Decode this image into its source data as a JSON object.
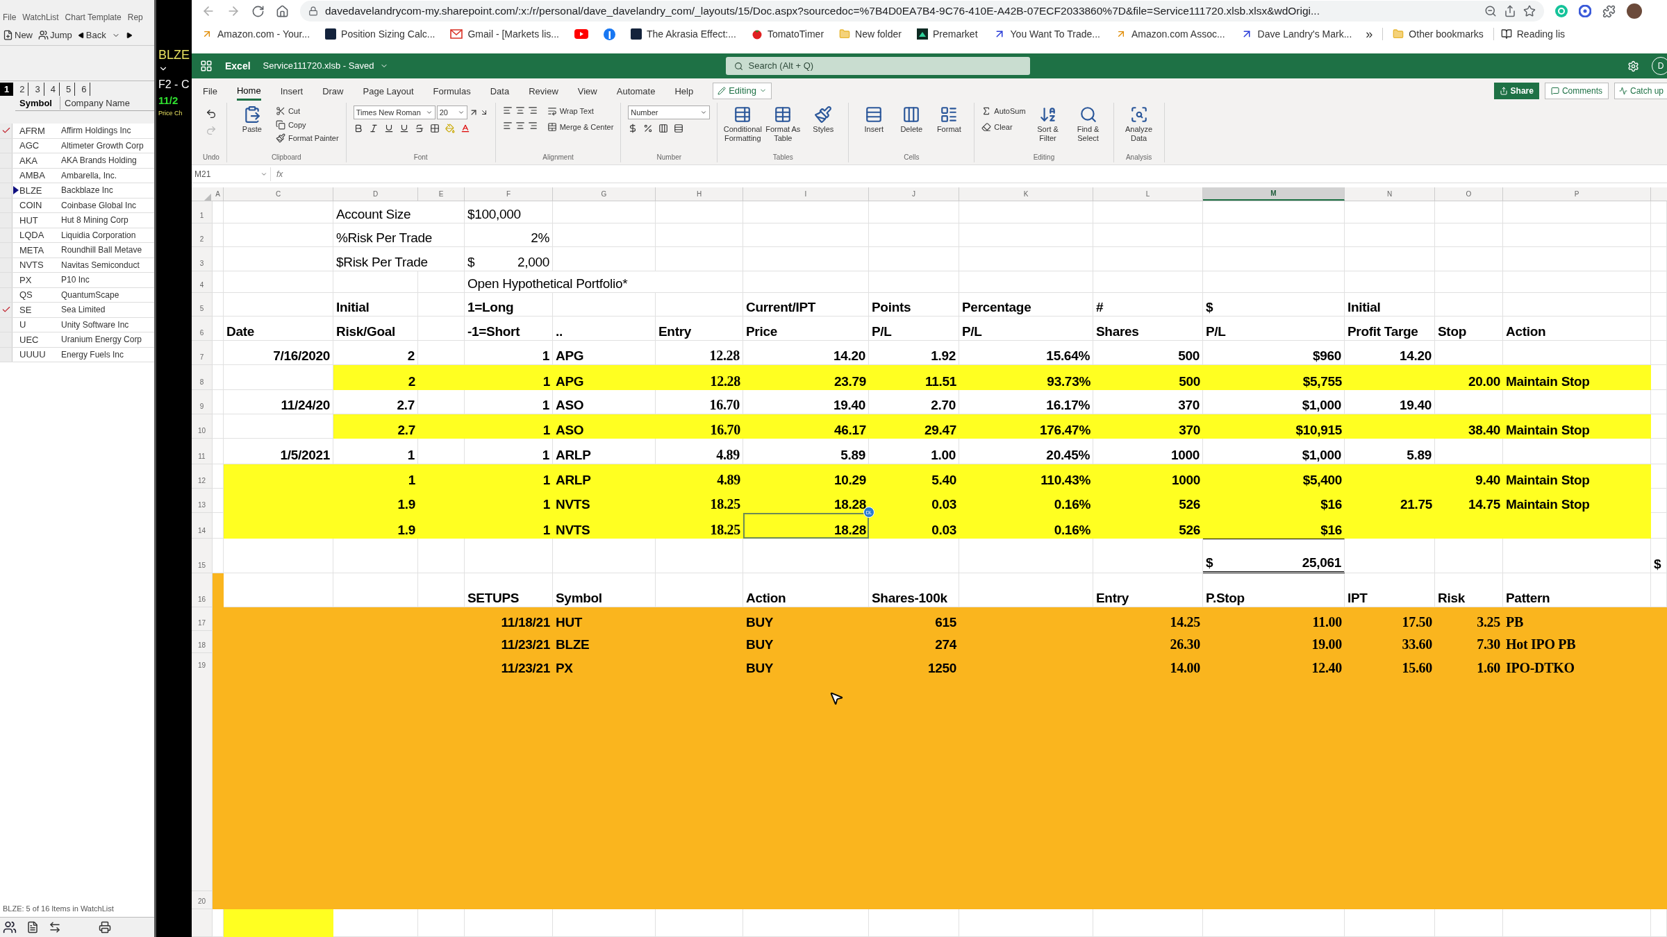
{
  "watchlist_app": {
    "menu": [
      "File",
      "WatchList",
      "Chart Template",
      "Rep"
    ],
    "toolbar": [
      "New",
      "Jump",
      "Back"
    ],
    "list_tabs": [
      {
        "label": "1",
        "selected": true
      },
      {
        "label": "2",
        "selected": false
      },
      {
        "label": "3",
        "selected": false
      },
      {
        "label": "4",
        "selected": false
      },
      {
        "label": "5",
        "selected": false
      },
      {
        "label": "6",
        "selected": false
      }
    ],
    "columns": [
      "Symbol",
      "Company Name"
    ],
    "rows": [
      {
        "symbol": "AFRM",
        "company": "Affirm Holdings Inc",
        "checked": true,
        "selected": false
      },
      {
        "symbol": "AGC",
        "company": "Altimeter Growth Corp",
        "checked": false,
        "selected": false
      },
      {
        "symbol": "AKA",
        "company": "AKA Brands Holding",
        "checked": false,
        "selected": false
      },
      {
        "symbol": "AMBA",
        "company": "Ambarella, Inc.",
        "checked": false,
        "selected": false
      },
      {
        "symbol": "BLZE",
        "company": "Backblaze Inc",
        "checked": false,
        "selected": true
      },
      {
        "symbol": "COIN",
        "company": "Coinbase Global Inc",
        "checked": false,
        "selected": false
      },
      {
        "symbol": "HUT",
        "company": "Hut 8 Mining Corp",
        "checked": false,
        "selected": false
      },
      {
        "symbol": "LQDA",
        "company": "Liquidia Corporation",
        "checked": false,
        "selected": false
      },
      {
        "symbol": "META",
        "company": "Roundhill Ball Metave",
        "checked": false,
        "selected": false
      },
      {
        "symbol": "NVTS",
        "company": "Navitas Semiconduct",
        "checked": false,
        "selected": false
      },
      {
        "symbol": "PX",
        "company": "P10 Inc",
        "checked": false,
        "selected": false
      },
      {
        "symbol": "QS",
        "company": "QuantumScape",
        "checked": false,
        "selected": false
      },
      {
        "symbol": "SE",
        "company": "Sea Limited",
        "checked": true,
        "selected": false
      },
      {
        "symbol": "U",
        "company": "Unity Software Inc",
        "checked": false,
        "selected": false
      },
      {
        "symbol": "UEC",
        "company": "Uranium Energy Corp",
        "checked": false,
        "selected": false
      },
      {
        "symbol": "UUUU",
        "company": "Energy Fuels Inc",
        "checked": false,
        "selected": false
      }
    ],
    "status": "BLZE: 5 of 16 Items in WatchList"
  },
  "chart_strip": {
    "symbol": "BLZE",
    "caption": "F2 - C",
    "date": "11/2",
    "label": "Price Ch"
  },
  "browser": {
    "url": "davedavelandrycom-my.sharepoint.com/:x:/r/personal/dave_davelandry_com/_layouts/15/Doc.aspx?sourcedoc=%7B4D0EA7B4-9C76-410E-A42B-07ECF2033860%7D&file=Service111720.xlsb.xlsx&wdOrigi...",
    "bookmarks": [
      {
        "kind": "amazon",
        "label": "Amazon.com - Your..."
      },
      {
        "kind": "badge",
        "label": "Position Sizing Calc..."
      },
      {
        "kind": "mail",
        "label": "Gmail - [Markets lis..."
      },
      {
        "kind": "video"
      },
      {
        "kind": "social"
      },
      {
        "kind": "badge",
        "label": "The Akrasia Effect:..."
      },
      {
        "kind": "tomato",
        "label": "TomatoTimer"
      },
      {
        "kind": "folder",
        "label": "New folder"
      },
      {
        "kind": "chart",
        "label": "Premarket"
      },
      {
        "kind": "arrow",
        "label": "You Want To Trade..."
      },
      {
        "kind": "amazon",
        "label": "Amazon.com Assoc..."
      },
      {
        "kind": "arrow",
        "label": "Dave Landry's Mark..."
      }
    ],
    "more": "»",
    "other": "Other bookmarks",
    "reading": "Reading lis"
  },
  "excel": {
    "app": "Excel",
    "file": "Service111720.xlsb - Saved",
    "search": "Search (Alt + Q)",
    "avatar": "D",
    "tabs": [
      {
        "label": "File",
        "selected": false
      },
      {
        "label": "Home",
        "selected": true
      },
      {
        "label": "Insert",
        "selected": false
      },
      {
        "label": "Draw",
        "selected": false
      },
      {
        "label": "Page Layout",
        "selected": false
      },
      {
        "label": "Formulas",
        "selected": false
      },
      {
        "label": "Data",
        "selected": false
      },
      {
        "label": "Review",
        "selected": false
      },
      {
        "label": "View",
        "selected": false
      },
      {
        "label": "Automate",
        "selected": false
      },
      {
        "label": "Help",
        "selected": false
      }
    ],
    "mode": "Editing",
    "share": "Share",
    "comments": "Comments",
    "catch_up": "Catch up",
    "groups": [
      {
        "kind": "undo",
        "name": "Undo"
      },
      {
        "kind": "clipboard",
        "name": "Clipboard",
        "buttons": [
          "Paste",
          "Cut",
          "Copy",
          "Format Painter"
        ]
      },
      {
        "kind": "font",
        "name": "Font",
        "font": "Times New Roman",
        "size": "20"
      },
      {
        "kind": "alignment",
        "name": "Alignment",
        "buttons": [
          "Wrap Text",
          "Merge & Center"
        ]
      },
      {
        "kind": "number",
        "name": "Number",
        "format": "Number"
      },
      {
        "kind": "tables",
        "name": "Tables",
        "buttons": [
          "Conditional Formatting",
          "Format As Table",
          "Styles"
        ]
      },
      {
        "kind": "cells",
        "name": "Cells",
        "buttons": [
          "Insert",
          "Delete",
          "Format"
        ]
      },
      {
        "kind": "editing",
        "name": "Editing",
        "buttons": [
          "AutoSum",
          "Clear",
          "Sort & Filter",
          "Find & Select"
        ]
      },
      {
        "kind": "analysis",
        "name": "Analysis",
        "buttons": [
          "Analyze Data"
        ]
      }
    ],
    "name_box": "M21",
    "fx": "fx",
    "columns": [
      {
        "label": "A",
        "selected": false
      },
      {
        "label": "C",
        "selected": false
      },
      {
        "label": "D",
        "selected": false
      },
      {
        "label": "E",
        "selected": false
      },
      {
        "label": "F",
        "selected": false
      },
      {
        "label": "G",
        "selected": false
      },
      {
        "label": "H",
        "selected": false
      },
      {
        "label": "I",
        "selected": false
      },
      {
        "label": "J",
        "selected": false
      },
      {
        "label": "K",
        "selected": false
      },
      {
        "label": "L",
        "selected": false
      },
      {
        "label": "M",
        "selected": true
      },
      {
        "label": "N",
        "selected": false
      },
      {
        "label": "O",
        "selected": false
      },
      {
        "label": "P",
        "selected": false
      }
    ],
    "rows": [
      {
        "number": "1",
        "cells": [
          {},
          {},
          {
            "kind": "wide",
            "text": "Account Size"
          },
          {
            "kind": "label",
            "text": "$100,000"
          },
          {},
          {},
          {},
          {},
          {},
          {},
          {},
          {},
          {},
          {},
          {}
        ]
      },
      {
        "number": "2",
        "cells": [
          {},
          {},
          {
            "kind": "wide",
            "text": "%Risk Per Trade"
          },
          {
            "kind": "amount",
            "text": "2%"
          },
          {},
          {},
          {},
          {},
          {},
          {},
          {},
          {},
          {},
          {},
          {}
        ]
      },
      {
        "number": "3",
        "cells": [
          {},
          {},
          {
            "kind": "wide",
            "text": "$Risk Per Trade"
          },
          {
            "kind": "currency",
            "symbol": "$",
            "text": "2,000"
          },
          {},
          {},
          {},
          {},
          {},
          {},
          {},
          {},
          {},
          {},
          {}
        ]
      },
      {
        "number": "4",
        "cells": [
          {},
          {},
          {},
          {},
          {
            "kind": "title",
            "text": "Open Hypothetical Portfolio*"
          },
          {},
          {},
          {},
          {},
          {},
          {},
          {},
          {},
          {}
        ]
      },
      {
        "number": "5",
        "cells": [
          {},
          {},
          {
            "kind": "heading",
            "text": "Initial"
          },
          {},
          {
            "kind": "heading",
            "text": "1=Long"
          },
          {},
          {},
          {
            "kind": "heading",
            "text": "Current/IPT"
          },
          {
            "kind": "heading",
            "text": "Points"
          },
          {
            "kind": "heading",
            "text": "Percentage"
          },
          {
            "kind": "heading",
            "text": "#"
          },
          {
            "kind": "heading",
            "text": "$"
          },
          {
            "kind": "heading",
            "text": "Initial"
          },
          {},
          {},
          {}
        ]
      },
      {
        "number": "6",
        "cells": [
          {},
          {
            "kind": "heading",
            "text": "Date"
          },
          {
            "kind": "heading",
            "text": "Risk/Goal"
          },
          {},
          {
            "kind": "heading",
            "text": "-1=Short"
          },
          {
            "kind": "heading",
            "text": ".."
          },
          {
            "kind": "heading",
            "text": "Entry"
          },
          {
            "kind": "heading",
            "text": "Price"
          },
          {
            "kind": "heading",
            "text": "P/L"
          },
          {
            "kind": "heading",
            "text": "P/L"
          },
          {
            "kind": "heading",
            "text": "Shares"
          },
          {
            "kind": "heading",
            "text": "P/L"
          },
          {
            "kind": "heading",
            "text": "Profit Targe"
          },
          {
            "kind": "heading",
            "text": "Stop"
          },
          {
            "kind": "heading",
            "text": "Action"
          },
          {}
        ]
      },
      {
        "number": "7",
        "cells": [
          {},
          {
            "kind": "value",
            "text": "7/16/2020"
          },
          {
            "kind": "value",
            "text": "2"
          },
          {},
          {
            "kind": "value",
            "text": "1"
          },
          {
            "kind": "heading",
            "text": "APG"
          },
          {
            "kind": "figure",
            "text": "12.28"
          },
          {
            "kind": "value",
            "text": "14.20"
          },
          {
            "kind": "value",
            "text": "1.92"
          },
          {
            "kind": "value",
            "text": "15.64%"
          },
          {
            "kind": "value",
            "text": "500"
          },
          {
            "kind": "value",
            "text": "$960"
          },
          {
            "kind": "value",
            "text": "14.20"
          },
          {},
          {},
          {}
        ]
      },
      {
        "number": "8",
        "color": "#ffff21",
        "cells": [
          {
            "color": "#ffffff"
          },
          {
            "color": "#ffffff"
          },
          {
            "kind": "value",
            "text": "2"
          },
          {},
          {
            "kind": "value",
            "text": "1"
          },
          {
            "kind": "heading",
            "text": "APG"
          },
          {
            "kind": "figure",
            "text": "12.28"
          },
          {
            "kind": "value",
            "text": "23.79"
          },
          {
            "kind": "value",
            "text": "11.51"
          },
          {
            "kind": "value",
            "text": "93.73%"
          },
          {
            "kind": "value",
            "text": "500"
          },
          {
            "kind": "value",
            "text": "$5,755"
          },
          {},
          {
            "kind": "value",
            "text": "20.00"
          },
          {
            "kind": "heading",
            "text": "Maintain Stop"
          },
          {
            "color": "#ffffff"
          }
        ]
      },
      {
        "number": "9",
        "cells": [
          {},
          {
            "kind": "value",
            "text": "11/24/20"
          },
          {
            "kind": "value",
            "text": "2.7"
          },
          {},
          {
            "kind": "value",
            "text": "1"
          },
          {
            "kind": "heading",
            "text": "ASO"
          },
          {
            "kind": "figure",
            "text": "16.70"
          },
          {
            "kind": "value",
            "text": "19.40"
          },
          {
            "kind": "value",
            "text": "2.70"
          },
          {
            "kind": "value",
            "text": "16.17%"
          },
          {
            "kind": "value",
            "text": "370"
          },
          {
            "kind": "value",
            "text": "$1,000"
          },
          {
            "kind": "value",
            "text": "19.40"
          },
          {},
          {},
          {}
        ]
      },
      {
        "number": "10",
        "color": "#ffff21",
        "cells": [
          {
            "color": "#ffffff"
          },
          {
            "color": "#ffffff"
          },
          {
            "kind": "value",
            "text": "2.7"
          },
          {},
          {
            "kind": "value",
            "text": "1"
          },
          {
            "kind": "heading",
            "text": "ASO"
          },
          {
            "kind": "figure",
            "text": "16.70"
          },
          {
            "kind": "value",
            "text": "46.17"
          },
          {
            "kind": "value",
            "text": "29.47"
          },
          {
            "kind": "value",
            "text": "176.47%"
          },
          {
            "kind": "value",
            "text": "370"
          },
          {
            "kind": "value",
            "text": "$10,915"
          },
          {},
          {
            "kind": "value",
            "text": "38.40"
          },
          {
            "kind": "heading",
            "text": "Maintain Stop"
          },
          {
            "color": "#ffffff"
          }
        ]
      },
      {
        "number": "11",
        "cells": [
          {},
          {
            "kind": "value",
            "text": "1/5/2021"
          },
          {
            "kind": "value",
            "text": "1"
          },
          {},
          {
            "kind": "value",
            "text": "1"
          },
          {
            "kind": "heading",
            "text": "ARLP"
          },
          {
            "kind": "figure",
            "text": "4.89"
          },
          {
            "kind": "value",
            "text": "5.89"
          },
          {
            "kind": "value",
            "text": "1.00"
          },
          {
            "kind": "value",
            "text": "20.45%"
          },
          {
            "kind": "value",
            "text": "1000"
          },
          {
            "kind": "value",
            "text": "$1,000"
          },
          {
            "kind": "value",
            "text": "5.89"
          },
          {},
          {},
          {}
        ]
      },
      {
        "number": "12",
        "color": "#ffff21",
        "cells": [
          {
            "color": "#ffffff"
          },
          {},
          {
            "kind": "value",
            "text": "1"
          },
          {},
          {
            "kind": "value",
            "text": "1"
          },
          {
            "kind": "heading",
            "text": "ARLP"
          },
          {
            "kind": "figure",
            "text": "4.89"
          },
          {
            "kind": "value",
            "text": "10.29"
          },
          {
            "kind": "value",
            "text": "5.40"
          },
          {
            "kind": "value",
            "text": "110.43%"
          },
          {
            "kind": "value",
            "text": "1000"
          },
          {
            "kind": "value",
            "text": "$5,400"
          },
          {},
          {
            "kind": "value",
            "text": "9.40"
          },
          {
            "kind": "heading",
            "text": "Maintain Stop"
          },
          {
            "color": "#ffffff"
          }
        ]
      },
      {
        "number": "13",
        "color": "#ffff21",
        "cells": [
          {
            "color": "#ffffff"
          },
          {},
          {
            "kind": "value",
            "text": "1.9"
          },
          {},
          {
            "kind": "value",
            "text": "1"
          },
          {
            "kind": "heading",
            "text": "NVTS"
          },
          {
            "kind": "figure",
            "text": "18.25"
          },
          {
            "kind": "value",
            "text": "18.28"
          },
          {
            "kind": "value",
            "text": "0.03"
          },
          {
            "kind": "value",
            "text": "0.16%"
          },
          {
            "kind": "value",
            "text": "526"
          },
          {
            "kind": "value",
            "text": "$16"
          },
          {
            "kind": "value",
            "text": "21.75"
          },
          {
            "kind": "value",
            "text": "14.75"
          },
          {
            "kind": "heading",
            "text": "Maintain Stop"
          },
          {
            "color": "#ffffff"
          }
        ]
      },
      {
        "number": "14",
        "color": "#ffff21",
        "cells": [
          {
            "color": "#ffffff"
          },
          {},
          {
            "kind": "value",
            "text": "1.9"
          },
          {},
          {
            "kind": "value",
            "text": "1"
          },
          {
            "kind": "heading",
            "text": "NVTS"
          },
          {
            "kind": "figure",
            "text": "18.25"
          },
          {
            "kind": "value",
            "text": "18.28",
            "collaborator": "DL"
          },
          {
            "kind": "value",
            "text": "0.03"
          },
          {
            "kind": "value",
            "text": "0.16%"
          },
          {
            "kind": "value",
            "text": "526"
          },
          {
            "kind": "value",
            "text": "$16"
          },
          {},
          {},
          {},
          {
            "color": "#ffffff"
          }
        ]
      },
      {
        "number": "15",
        "cells": [
          {},
          {},
          {},
          {},
          {},
          {},
          {},
          {},
          {},
          {},
          {},
          {
            "kind": "total",
            "symbol": "$",
            "text": "25,061"
          },
          {},
          {},
          {},
          {
            "kind": "heading",
            "text": "$"
          }
        ]
      },
      {
        "number": "16",
        "cells": [
          {
            "color": "#fab51e"
          },
          {},
          {},
          {},
          {
            "kind": "heading",
            "text": "SETUPS"
          },
          {
            "kind": "heading",
            "text": "Symbol"
          },
          {},
          {
            "kind": "heading",
            "text": "Action"
          },
          {
            "kind": "heading",
            "text": "Shares-100k"
          },
          {},
          {
            "kind": "heading",
            "text": "Entry"
          },
          {
            "kind": "heading",
            "text": "P.Stop"
          },
          {
            "kind": "heading",
            "text": "IPT"
          },
          {
            "kind": "heading",
            "text": "Risk"
          },
          {
            "kind": "heading",
            "text": "Pattern"
          },
          {}
        ]
      },
      {
        "number": "17",
        "color": "#fab51e",
        "cells": [
          {},
          {},
          {},
          {},
          {
            "kind": "value",
            "text": "11/18/21"
          },
          {
            "kind": "heading",
            "text": "HUT"
          },
          {},
          {
            "kind": "heading",
            "text": "BUY"
          },
          {
            "kind": "value",
            "text": "615"
          },
          {},
          {
            "kind": "figure",
            "text": "14.25"
          },
          {
            "kind": "figure",
            "text": "11.00"
          },
          {
            "kind": "figure",
            "text": "17.50"
          },
          {
            "kind": "figure",
            "text": "3.25"
          },
          {
            "kind": "serif",
            "text": "PB"
          },
          {}
        ]
      },
      {
        "number": "18",
        "color": "#fab51e",
        "cells": [
          {},
          {},
          {},
          {},
          {
            "kind": "value",
            "text": "11/23/21"
          },
          {
            "kind": "heading",
            "text": "BLZE"
          },
          {},
          {
            "kind": "heading",
            "text": "BUY"
          },
          {
            "kind": "value",
            "text": "274"
          },
          {},
          {
            "kind": "figure",
            "text": "26.30"
          },
          {
            "kind": "figure",
            "text": "19.00"
          },
          {
            "kind": "figure",
            "text": "33.60"
          },
          {
            "kind": "figure",
            "text": "7.30"
          },
          {
            "kind": "serif",
            "text": "Hot IPO PB"
          },
          {}
        ]
      },
      {
        "number": "19",
        "color": "#fab51e",
        "cells": [
          {},
          {},
          {},
          {},
          {
            "kind": "value",
            "text": "11/23/21"
          },
          {
            "kind": "heading",
            "text": "PX"
          },
          {},
          {
            "kind": "heading",
            "text": "BUY"
          },
          {
            "kind": "value",
            "text": "1250"
          },
          {},
          {
            "kind": "figure",
            "text": "14.00"
          },
          {
            "kind": "figure",
            "text": "12.40"
          },
          {
            "kind": "figure",
            "text": "15.60"
          },
          {
            "kind": "figure",
            "text": "1.60"
          },
          {
            "kind": "serif",
            "text": "IPO-DTKO"
          },
          {}
        ]
      },
      {
        "number": "20",
        "color": "#fab51e",
        "cells": [
          {},
          {},
          {},
          {},
          {},
          {},
          {},
          {},
          {},
          {},
          {},
          {},
          {},
          {},
          {},
          {}
        ]
      },
      {
        "cells": [
          {},
          {
            "color": "#ffff21"
          },
          {},
          {},
          {},
          {},
          {},
          {},
          {},
          {},
          {},
          {},
          {},
          {},
          {},
          {}
        ]
      }
    ]
  }
}
